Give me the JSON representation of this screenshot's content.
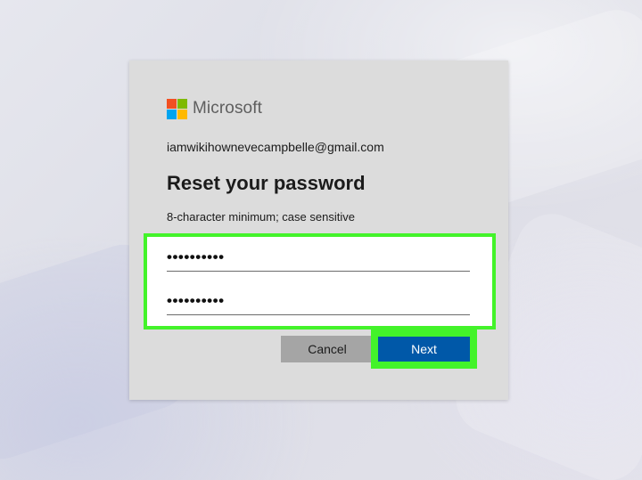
{
  "brand": {
    "name": "Microsoft",
    "logo_colors": [
      "#f25022",
      "#7fba00",
      "#00a4ef",
      "#ffb900"
    ]
  },
  "account": {
    "email": "iamwikihownevecampbelle@gmail.com"
  },
  "page": {
    "title": "Reset your password",
    "hint": "8-character minimum; case sensitive"
  },
  "fields": {
    "new_password_value": "••••••••••",
    "confirm_password_value": "••••••••••"
  },
  "buttons": {
    "cancel_label": "Cancel",
    "next_label": "Next"
  },
  "colors": {
    "highlight": "#43f32a",
    "primary_button": "#0058a8",
    "secondary_button": "#a5a5a5",
    "dialog_background": "#dcdcdc"
  }
}
